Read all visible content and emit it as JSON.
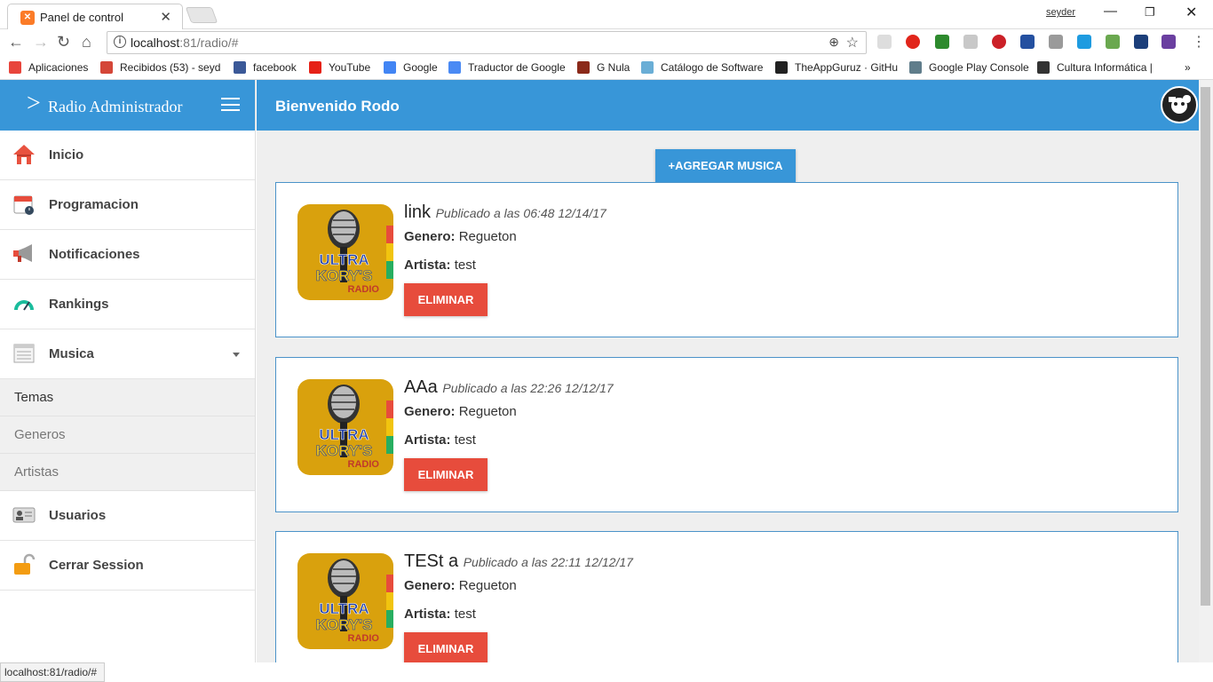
{
  "browser": {
    "tab_title": "Panel de control",
    "user": "seyder",
    "url_host": "localhost",
    "url_rest": ":81/radio/#",
    "status_url": "localhost:81/radio/#"
  },
  "bookmarks": [
    {
      "label": "Aplicaciones",
      "color": "#e8453c"
    },
    {
      "label": "Recibidos (53) - seyd",
      "color": "#d44638"
    },
    {
      "label": "facebook",
      "color": "#3b5998"
    },
    {
      "label": "YouTube",
      "color": "#e62117"
    },
    {
      "label": "Google",
      "color": "#4285f4"
    },
    {
      "label": "Traductor de Google",
      "color": "#4a8af4"
    },
    {
      "label": "G Nula",
      "color": "#8b2a1a"
    },
    {
      "label": "Catálogo de Software",
      "color": "#6aaed6"
    },
    {
      "label": "TheAppGuruz · GitHu",
      "color": "#222222"
    },
    {
      "label": "Google Play Console",
      "color": "#607d8b"
    },
    {
      "label": "Cultura Informática |",
      "color": "#333333"
    }
  ],
  "sidebar": {
    "brand_arrow": ">",
    "brand": "Radio Administrador",
    "items": [
      {
        "label": "Inicio",
        "icon": "home-icon"
      },
      {
        "label": "Programacion",
        "icon": "calendar-icon"
      },
      {
        "label": "Notificaciones",
        "icon": "megaphone-icon"
      },
      {
        "label": "Rankings",
        "icon": "gauge-icon"
      },
      {
        "label": "Musica",
        "icon": "list-icon"
      }
    ],
    "submenu": [
      "Temas",
      "Generos",
      "Artistas"
    ],
    "items_bottom": [
      {
        "label": "Usuarios",
        "icon": "id-card-icon"
      },
      {
        "label": "Cerrar Session",
        "icon": "padlock-icon"
      }
    ]
  },
  "header": {
    "welcome": "Bienvenido Rodo"
  },
  "add_button": "+AGREGAR MUSICA",
  "cover_text": {
    "line1": "ULTRA",
    "line2": "KORY'S",
    "line3": "RADIO"
  },
  "songs": [
    {
      "title": "link",
      "published": "Publicado a las 06:48 12/14/17",
      "genre_label": "Genero:",
      "genre": "Regueton",
      "artist_label": "Artista:",
      "artist": "test",
      "delete": "ELIMINAR"
    },
    {
      "title": "AAa",
      "published": "Publicado a las 22:26 12/12/17",
      "genre_label": "Genero:",
      "genre": "Regueton",
      "artist_label": "Artista:",
      "artist": "test",
      "delete": "ELIMINAR"
    },
    {
      "title": "TESt a",
      "published": "Publicado a las 22:11 12/12/17",
      "genre_label": "Genero:",
      "genre": "Regueton",
      "artist_label": "Artista:",
      "artist": "test",
      "delete": "ELIMINAR"
    }
  ],
  "colors": {
    "primary": "#3896d8",
    "danger": "#e74c3c",
    "cover": "#d9a10d"
  }
}
